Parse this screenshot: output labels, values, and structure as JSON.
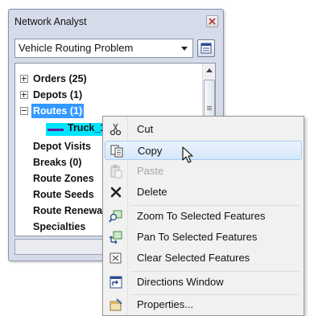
{
  "window": {
    "title": "Network Analyst"
  },
  "problem_selector": {
    "selected": "Vehicle Routing Problem"
  },
  "tree": {
    "items": [
      {
        "label": "Orders (25)",
        "expander": "plus"
      },
      {
        "label": "Depots (1)",
        "expander": "plus"
      },
      {
        "label": "Routes (1)",
        "expander": "minus",
        "selected": true
      },
      {
        "label": "Truck_1",
        "child": true,
        "highlighted": true,
        "line_color": "#6a1b9a"
      },
      {
        "label": "Depot Visits"
      },
      {
        "label": "Breaks (0)"
      },
      {
        "label": "Route Zones"
      },
      {
        "label": "Route Seeds"
      },
      {
        "label": "Route Renewals"
      },
      {
        "label": "Specialties"
      }
    ]
  },
  "context_menu": {
    "items": [
      {
        "label": "Cut",
        "icon": "scissors-icon"
      },
      {
        "label": "Copy",
        "icon": "copy-icon",
        "highlighted": true
      },
      {
        "label": "Paste",
        "icon": "paste-icon",
        "disabled": true
      },
      {
        "label": "Delete",
        "icon": "delete-x-icon"
      },
      {
        "label": "Zoom To Selected Features",
        "icon": "zoom-to-selected-icon"
      },
      {
        "label": "Pan To Selected Features",
        "icon": "pan-to-selected-icon"
      },
      {
        "label": "Clear Selected Features",
        "icon": "clear-selection-icon"
      },
      {
        "label": "Directions Window",
        "icon": "directions-window-icon"
      },
      {
        "label": "Properties...",
        "icon": "properties-icon"
      }
    ]
  },
  "colors": {
    "selection_blue": "#3399ff",
    "highlight_cyan": "#00e5ff",
    "route_line": "#6a1b9a",
    "menu_highlight": "#d5e7fb"
  }
}
